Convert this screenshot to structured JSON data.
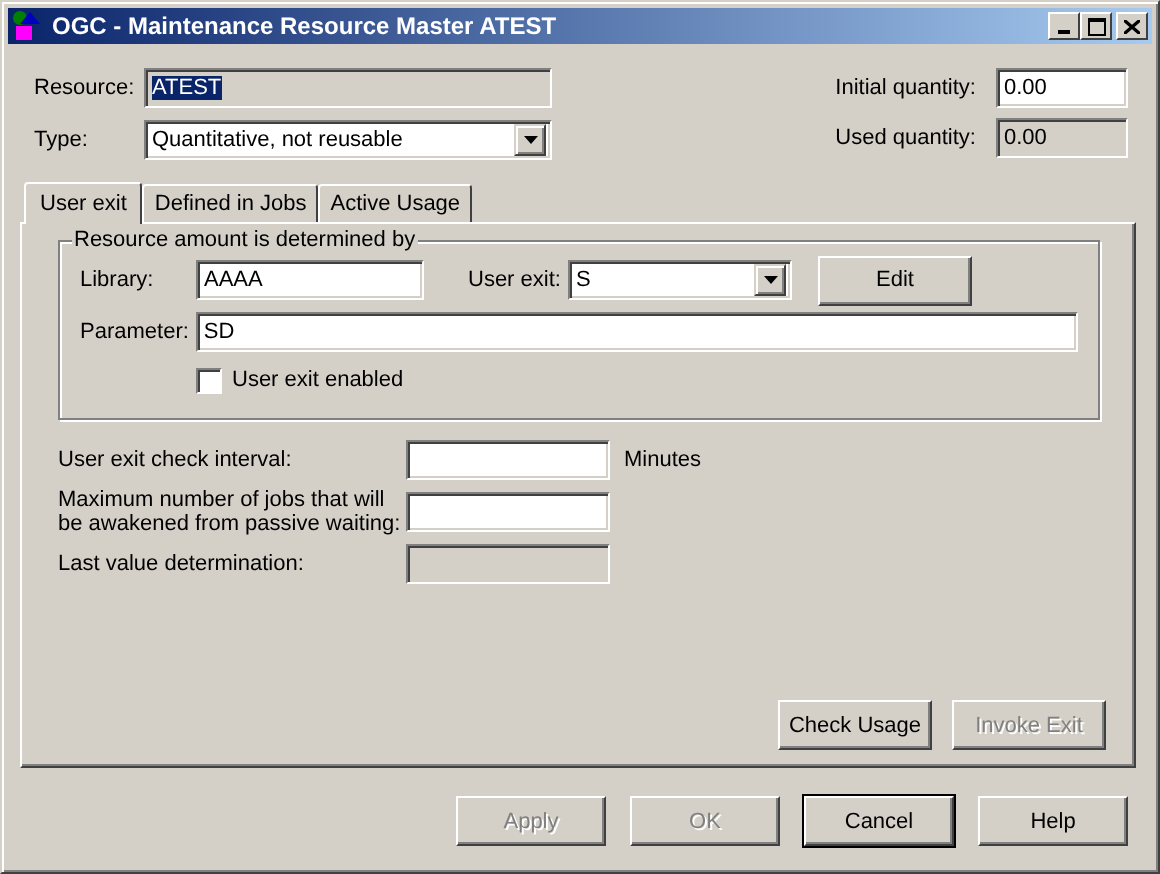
{
  "window": {
    "title": "OGC - Maintenance Resource Master ATEST"
  },
  "resource": {
    "label": "Resource:",
    "value": "ATEST",
    "disabled": true,
    "highlighted": true
  },
  "type": {
    "label": "Type:",
    "value": "Quantitative, not reusable"
  },
  "initial_quantity": {
    "label": "Initial quantity:",
    "value": "0.00",
    "disabled": false
  },
  "used_quantity": {
    "label": "Used quantity:",
    "value": "0.00",
    "disabled": true
  },
  "tabs": [
    {
      "label": "User exit",
      "selected": true
    },
    {
      "label": "Defined in Jobs",
      "selected": false
    },
    {
      "label": "Active Usage",
      "selected": false
    }
  ],
  "group": {
    "title": "Resource amount is determined by",
    "library": {
      "label": "Library:",
      "value": "AAAA"
    },
    "user_exit": {
      "label": "User exit:",
      "value": "S"
    },
    "edit_button": {
      "label": "Edit",
      "disabled": false
    },
    "parameter": {
      "label": "Parameter:",
      "value": "SD"
    },
    "enabled_checkbox": {
      "label": "User exit enabled",
      "checked": false
    }
  },
  "check_interval": {
    "label": "User exit check interval:",
    "unit": "Minutes",
    "disabled": false
  },
  "max_jobs": {
    "label_lines": [
      "Maximum number of jobs that will",
      "be awakened from passive waiting:"
    ],
    "disabled": false
  },
  "last_value": {
    "label": "Last value determination:",
    "disabled": true
  },
  "panel_buttons": [
    {
      "label": "Check Usage",
      "disabled": false
    },
    {
      "label": "Invoke Exit",
      "disabled": true
    }
  ],
  "buttons": [
    {
      "label": "Apply",
      "disabled": true,
      "default": false
    },
    {
      "label": "OK",
      "disabled": true,
      "default": false
    },
    {
      "label": "Cancel",
      "disabled": false,
      "default": true
    },
    {
      "label": "Help",
      "disabled": false,
      "default": false
    }
  ]
}
